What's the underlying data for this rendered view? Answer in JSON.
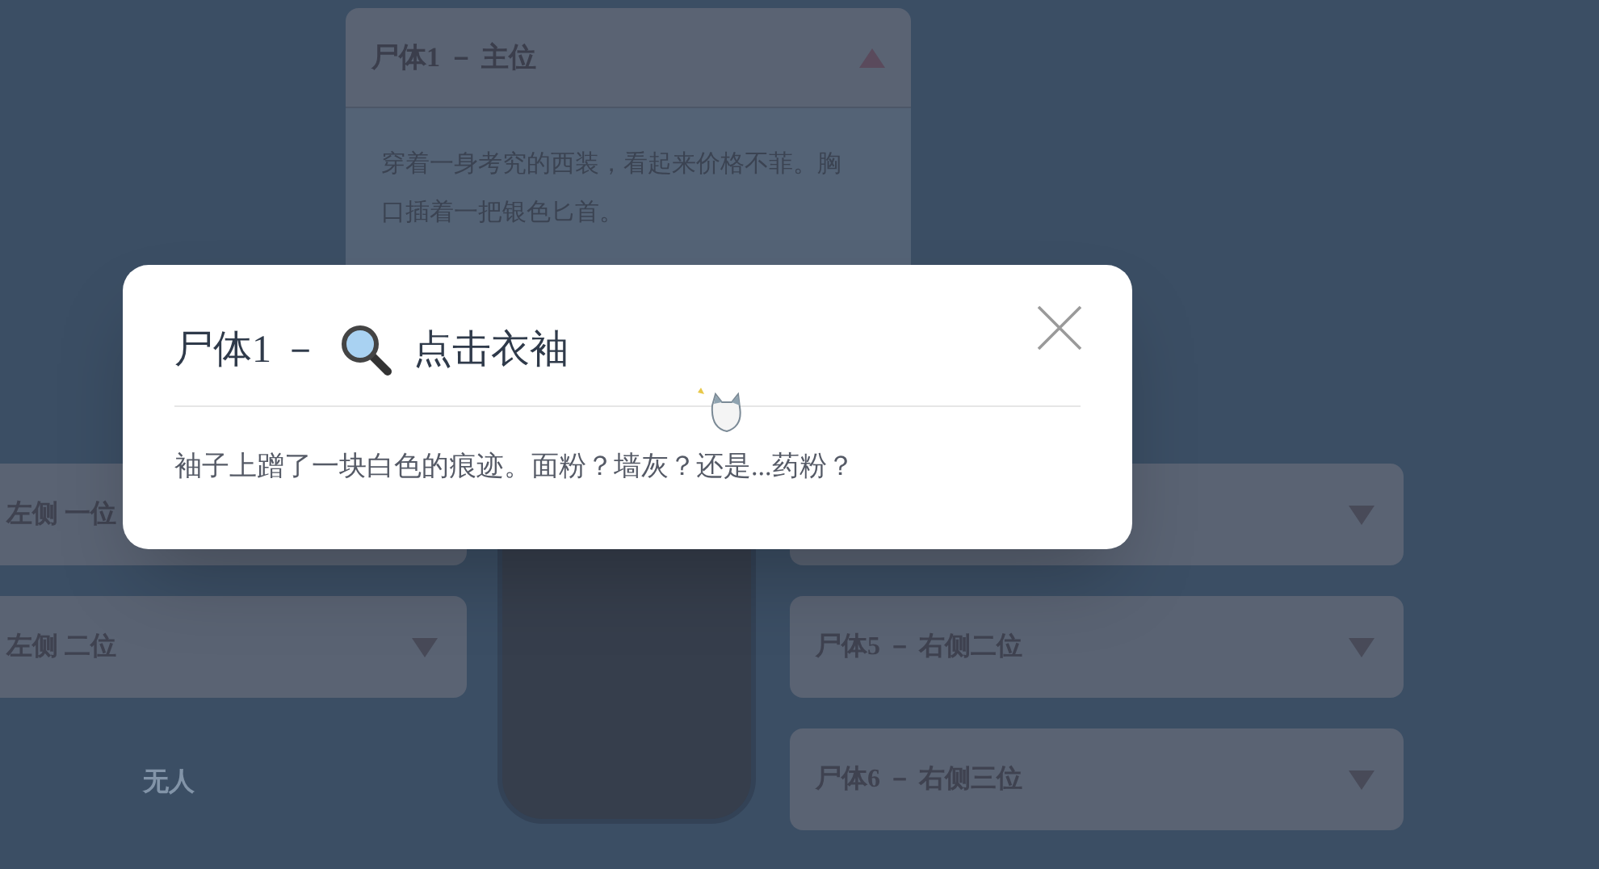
{
  "top_card": {
    "title": "尸体1 － 主位",
    "expanded": true,
    "description": "穿着一身考究的西装，看起来价格不菲。胸口插着一把银色匕首。"
  },
  "left_slots": [
    {
      "label": "左侧 一位"
    },
    {
      "label": "左侧 二位",
      "expanded": false
    }
  ],
  "left_empty_label": "无人",
  "right_slots": [
    {
      "expanded": false
    },
    {
      "label": "尸体5 － 右侧二位",
      "expanded": false
    },
    {
      "label": "尸体6 － 右侧三位",
      "expanded": false
    }
  ],
  "modal": {
    "title_prefix": "尸体1 －",
    "title_action": "点击衣袖",
    "message": "袖子上蹭了一块白色的痕迹。面粉？墙灰？还是...药粉？"
  }
}
